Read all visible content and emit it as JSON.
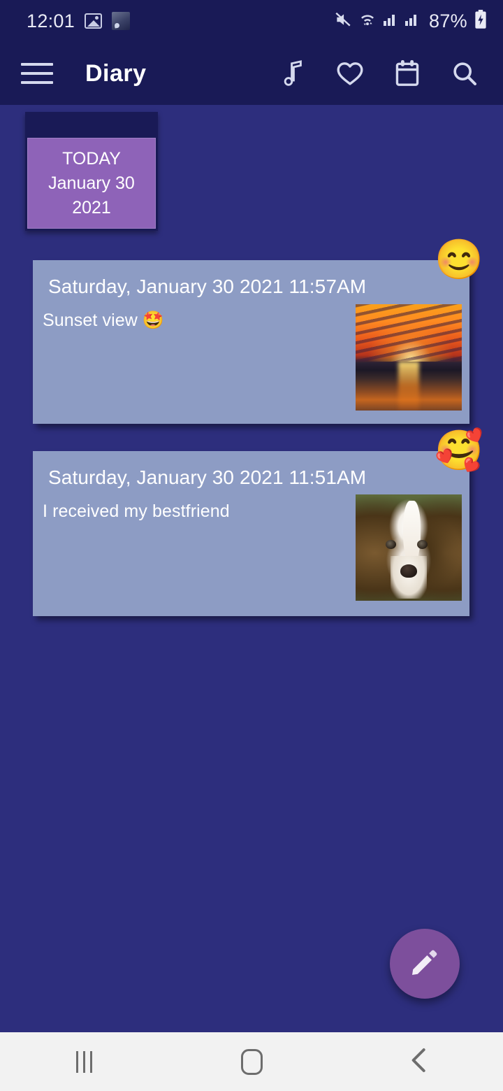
{
  "status_bar": {
    "clock": "12:01",
    "battery_percent": "87%",
    "icons": [
      "gallery-icon",
      "screenshot-thumbnail",
      "mute-icon",
      "wifi-icon",
      "signal-sim1-icon",
      "signal-sim2-icon",
      "battery-charging-icon"
    ]
  },
  "app_bar": {
    "title": "Diary",
    "menu_icon": "hamburger-menu-icon",
    "actions": [
      {
        "name": "music-icon",
        "label": "Music"
      },
      {
        "name": "favorite-icon",
        "label": "Favorites"
      },
      {
        "name": "calendar-icon",
        "label": "Calendar"
      },
      {
        "name": "search-icon",
        "label": "Search"
      }
    ]
  },
  "date_card": {
    "today_label": "TODAY",
    "date": "January 30",
    "year": "2021"
  },
  "entries": [
    {
      "datetime": "Saturday, January 30 2021 11:57AM",
      "text": "Sunset view 🤩",
      "mood": "😊",
      "photo": "sunset-photo"
    },
    {
      "datetime": "Saturday, January 30 2021 11:51AM",
      "text": "I received my bestfriend",
      "mood": "🥰",
      "photo": "dog-photo"
    }
  ],
  "fab": {
    "icon": "pencil-icon",
    "label": "New entry"
  },
  "nav_bar": {
    "recents_label": "Recents",
    "home_label": "Home",
    "back_label": "Back"
  },
  "colors": {
    "background": "#2d2e7d",
    "appbar": "#191a56",
    "card": "#8d9cc4",
    "accent_purple": "#8e63b8",
    "fab": "#7d4f9c"
  }
}
